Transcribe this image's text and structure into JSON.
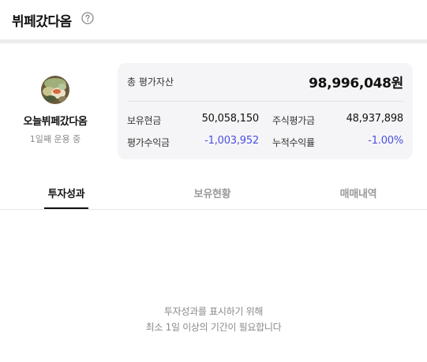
{
  "header": {
    "title": "뷔페갔다옴",
    "help_icon": "question-circle-icon"
  },
  "profile": {
    "name": "오늘뷔페갔다옴",
    "subtitle": "1일째 운용 중",
    "avatar_icon": "food-photo-avatar"
  },
  "assets": {
    "total_label": "총 평가자산",
    "total_value": "98,996,048원",
    "stats": {
      "cash_label": "보유현금",
      "cash_value": "50,058,150",
      "stock_label": "주식평가금",
      "stock_value": "48,937,898",
      "profit_label": "평가수익금",
      "profit_value": "-1,003,952",
      "cumulative_label": "누적수익률",
      "cumulative_value": "-1.00%"
    }
  },
  "tabs": [
    {
      "label": "투자성과",
      "active": true
    },
    {
      "label": "보유현황",
      "active": false
    },
    {
      "label": "매매내역",
      "active": false
    }
  ],
  "empty_state": {
    "line1": "투자성과를 표시하기 위해",
    "line2": "최소 1일 이상의 기간이 필요합니다"
  },
  "colors": {
    "negative": "#4a4fe0",
    "card_bg": "#f5f5f7",
    "divider": "#ececec"
  }
}
